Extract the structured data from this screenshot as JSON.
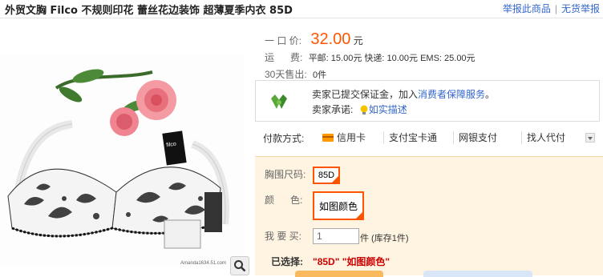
{
  "header": {
    "title": "外贸文胸 Filco 不规则印花 蕾丝花边装饰 超薄夏季内衣 85D",
    "report_label": "举报此商品",
    "no_fake_label": "无货举报"
  },
  "product_image": {
    "brand_tag": "filco",
    "watermark": "Amanda1634.51.com",
    "zoom_icon": "magnifier-icon"
  },
  "price": {
    "label": "一 口 价:",
    "value": "32.00",
    "unit": "元"
  },
  "shipping": {
    "label": "运      费:",
    "text": "平邮: 15.00元 快递: 10.00元 EMS: 25.00元"
  },
  "sales": {
    "label": "30天售出:",
    "value": "0件"
  },
  "promise": {
    "line1_prefix": "卖家已提交保证金，加入",
    "line1_link": "消费者保障服务",
    "line1_suffix": "。",
    "line2_prefix": "卖家承诺:",
    "line2_link": "如实描述",
    "icon": "handshake-icon"
  },
  "payment": {
    "label": "付款方式:",
    "methods": [
      "信用卡",
      "支付宝卡通",
      "网银支付",
      "找人代付"
    ],
    "card_icon": "credit-card-icon"
  },
  "sku": {
    "size_label": "胸围尺码:",
    "size_value": "85D",
    "color_label": "颜      色:",
    "color_value": "如图颜色",
    "qty_label": "我 要 买:",
    "qty_value": "1",
    "qty_unit": "件 (库存1件)",
    "selected_label": "已选择:",
    "selected_value": "\"85D\" \"如图颜色\""
  }
}
